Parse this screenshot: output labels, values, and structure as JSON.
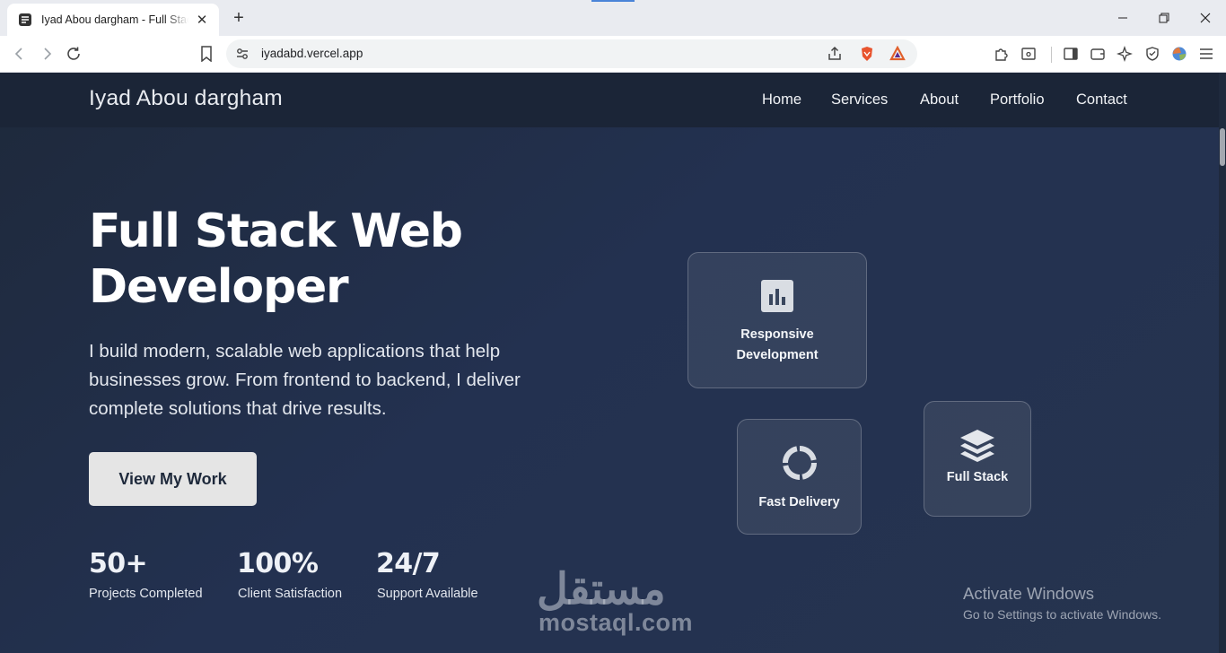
{
  "browser": {
    "tab_title": "Iyad Abou dargham - Full Stack Web Developer",
    "url": "iyadabd.vercel.app",
    "accent": "#4a84d8"
  },
  "site": {
    "brand": "Iyad Abou dargham",
    "nav": [
      "Home",
      "Services",
      "About",
      "Portfolio",
      "Contact"
    ],
    "hero": {
      "title_line1": "Full Stack Web",
      "title_line2": "Developer",
      "subtitle": "I build modern, scalable web applications that help businesses grow. From frontend to backend, I deliver complete solutions that drive results.",
      "cta": "View My Work"
    },
    "stats": [
      {
        "value": "50+",
        "label": "Projects Completed"
      },
      {
        "value": "100%",
        "label": "Client Satisfaction"
      },
      {
        "value": "24/7",
        "label": "Support Available"
      }
    ],
    "cards": [
      {
        "line1": "Responsive",
        "line2": "Development",
        "icon": "chart-bar-icon"
      },
      {
        "label": "Fast Delivery",
        "icon": "loader-ring-icon"
      },
      {
        "label": "Full Stack",
        "icon": "layers-icon"
      }
    ],
    "colors": {
      "background": "#1e293b",
      "header": "#1b2537",
      "cta_bg": "#e5e5e5"
    }
  },
  "watermark": {
    "arabic": "مستقل",
    "latin": "mostaql.com"
  },
  "activation": {
    "title": "Activate Windows",
    "subtitle": "Go to Settings to activate Windows."
  }
}
